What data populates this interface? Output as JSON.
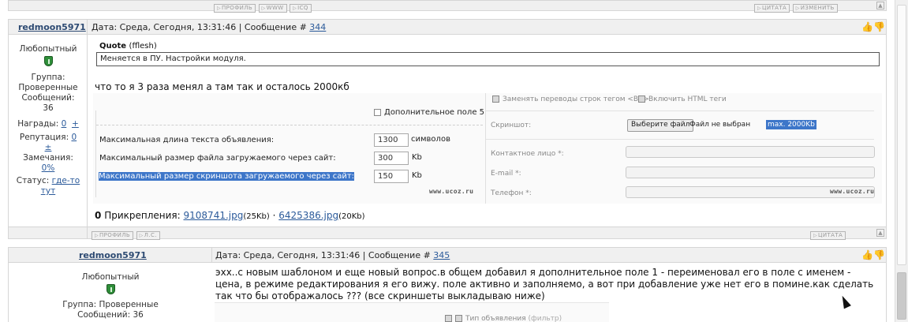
{
  "top_bar": {
    "profile": "ПРОФИЛЬ",
    "www": "WWW",
    "icq": "ICQ",
    "quote": "ЦИТАТА",
    "edit": "ИЗМЕНИТЬ"
  },
  "post1": {
    "username": "redmoon5971",
    "meta_prefix": "Дата: Среда, Сегодня, 13:31:46 | Сообщение # ",
    "number": "344",
    "rank": "Любопытный",
    "group_label": "Группа:",
    "group": "Проверенные",
    "messages_label": "Сообщений:",
    "messages": "36",
    "awards_label": "Награды:",
    "awards": "0",
    "plus": "+",
    "reputation_label": "Репутация:",
    "reputation": "0",
    "pm": "±",
    "remarks_label": "Замечания:",
    "remarks": "0%",
    "status_label": "Статус:",
    "status": "где-то тут",
    "quote_label": "Quote",
    "quote_author": "(fflesh)",
    "quote_text": "Меняется в ПУ. Настройки модуля.",
    "body": "что то я 3 раза менял а там так и осталось 2000кб",
    "attach_label": "Прикрепления:",
    "file1": "9108741.jpg",
    "file1_size": "(25Kb)",
    "sep": "·",
    "file2": "6425386.jpg",
    "file2_size": "(20Kb)"
  },
  "shot": {
    "extra_field": "Дополнительное поле 5",
    "max_len": "Максимальная длина текста объявления:",
    "max_len_val": "1300",
    "max_len_unit": "символов",
    "max_file": "Максимальный размер файла загружаемого через сайт:",
    "max_file_val": "300",
    "max_file_unit": "Kb",
    "max_shot": "Максимальный размер скриншота загружаемого через сайт:",
    "max_shot_val": "150",
    "max_shot_unit": "Kb",
    "watermark": "www.ucoz.ru",
    "br_option": "Заменять переводы строк тегом <BR>",
    "html_option": "Включить HTML теги",
    "screenshot_label": "Скриншот:",
    "choose_file": "Выберите файл",
    "no_file": "Файл не выбран",
    "max_note": "max. 2000Kb",
    "contact": "Контактное лицо *:",
    "email": "E-mail *:",
    "phone": "Телефон *:"
  },
  "mid_bar": {
    "profile": "ПРОФИЛЬ",
    "pm": "Л.С.",
    "quote": "ЦИТАТА"
  },
  "post2": {
    "username": "redmoon5971",
    "meta_prefix": "Дата: Среда, Сегодня, 13:31:46 | Сообщение # ",
    "number": "345",
    "rank": "Любопытный",
    "group_line": "Группа: Проверенные",
    "messages_line": "Сообщений: 36",
    "body": "эхх..с новым шаблоном и еще новый вопрос.в общем добавил я дополнительное поле 1 - переименовал его в поле с именем - цена, в режиме редактирования я его вижу. поле активно и заполняемо, а вот при добавление уже нет его в помине.как сделать так что бы отображалось ??? (все скриншеты выкладываю ниже)",
    "peek_label": "Тип объявления",
    "peek_hint": "(фильтр)"
  }
}
